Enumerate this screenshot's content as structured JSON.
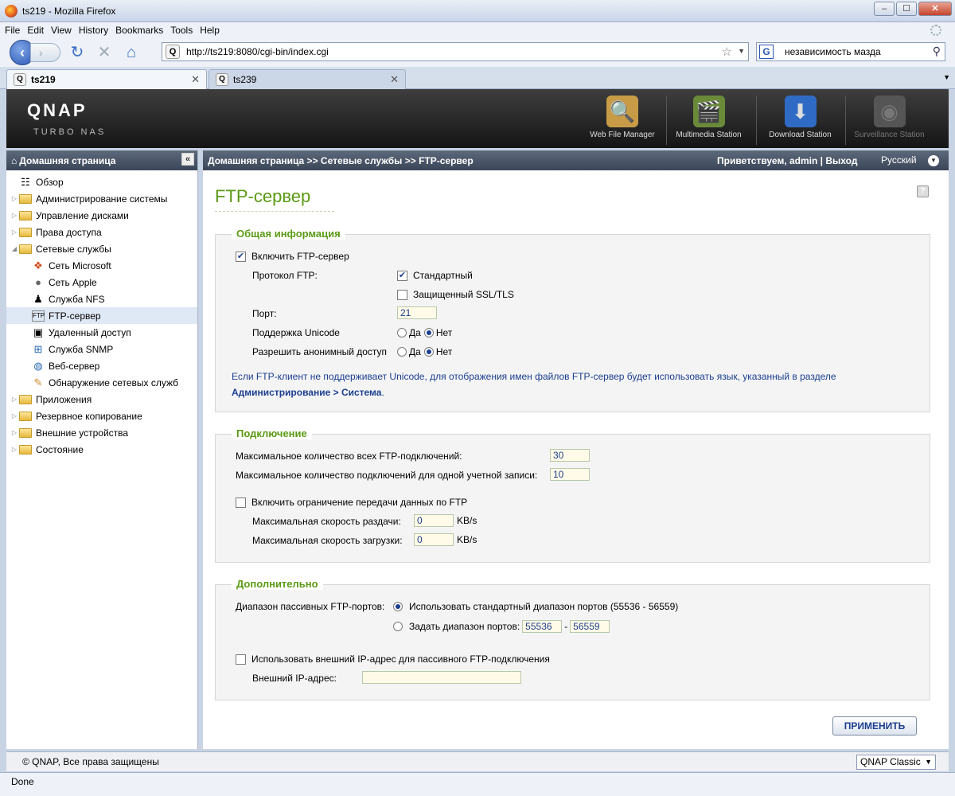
{
  "window": {
    "title": "ts219 - Mozilla Firefox"
  },
  "menubar": {
    "items": [
      "File",
      "Edit",
      "View",
      "History",
      "Bookmarks",
      "Tools",
      "Help"
    ]
  },
  "navbar": {
    "url": "http://ts219:8080/cgi-bin/index.cgi",
    "search_query": "независимость мазда"
  },
  "tabs": [
    {
      "label": "ts219"
    },
    {
      "label": "ts239"
    }
  ],
  "header": {
    "logo": "QNAP",
    "subtitle": "TURBO NAS",
    "apps": [
      "Web File Manager",
      "Multimedia Station",
      "Download Station",
      "Surveillance Station"
    ]
  },
  "sidebar": {
    "title": "Домашняя страница",
    "items": [
      {
        "label": "Обзор"
      },
      {
        "label": "Администрирование системы"
      },
      {
        "label": "Управление дисками"
      },
      {
        "label": "Права доступа"
      },
      {
        "label": "Сетевые службы"
      },
      {
        "label": "Сеть Microsoft"
      },
      {
        "label": "Сеть Apple"
      },
      {
        "label": "Служба NFS"
      },
      {
        "label": "FTP-сервер"
      },
      {
        "label": "Удаленный доступ"
      },
      {
        "label": "Служба SNMP"
      },
      {
        "label": "Веб-сервер"
      },
      {
        "label": "Обнаружение сетевых служб"
      },
      {
        "label": "Приложения"
      },
      {
        "label": "Резервное копирование"
      },
      {
        "label": "Внешние устройства"
      },
      {
        "label": "Состояние"
      }
    ]
  },
  "main": {
    "breadcrumb": "Домашняя страница >> Сетевые службы >> FTP-сервер",
    "welcome": "Приветствуем,",
    "user": "admin",
    "logout": "Выход",
    "language": "Русский",
    "page_title": "FTP-сервер"
  },
  "general": {
    "legend": "Общая информация",
    "enable_ftp": "Включить FTP-сервер",
    "protocol_label": "Протокол FTP:",
    "protocol_standard": "Стандартный",
    "protocol_ssl": "Защищенный SSL/TLS",
    "port_label": "Порт:",
    "port_value": "21",
    "unicode_label": "Поддержка Unicode",
    "anon_label": "Разрешить анонимный доступ",
    "yes": "Да",
    "no": "Нет",
    "note": "Если FTP-клиент не поддерживает Unicode, для отображения имен файлов FTP-сервер будет использовать язык, указанный в разделе",
    "note_link": "Администрирование > Система"
  },
  "connection": {
    "legend": "Подключение",
    "max_all_label": "Максимальное количество всех FTP-подключений:",
    "max_all_value": "30",
    "max_account_label": "Максимальное количество подключений для одной учетной записи:",
    "max_account_value": "10",
    "limit_label": "Включить ограничение передачи данных по FTP",
    "upload_label": "Максимальная скорость раздачи:",
    "upload_value": "0",
    "download_label": "Максимальная скорость загрузки:",
    "download_value": "0",
    "unit": "KB/s"
  },
  "advanced": {
    "legend": "Дополнительно",
    "passive_label": "Диапазон пассивных FTP-портов:",
    "use_default": "Использовать стандартный диапазон портов (55536 - 56559)",
    "custom_range": "Задать диапазон портов:",
    "range_from": "55536",
    "range_sep": "-",
    "range_to": "56559",
    "external_ip_check": "Использовать внешний IP-адрес для пассивного FTP-подключения",
    "external_ip_label": "Внешний IP-адрес:",
    "external_ip_value": ""
  },
  "apply_label": "ПРИМЕНИТЬ",
  "footer": {
    "copyright": "© QNAP, Все права защищены",
    "theme": "QNAP Classic"
  },
  "status": "Done"
}
